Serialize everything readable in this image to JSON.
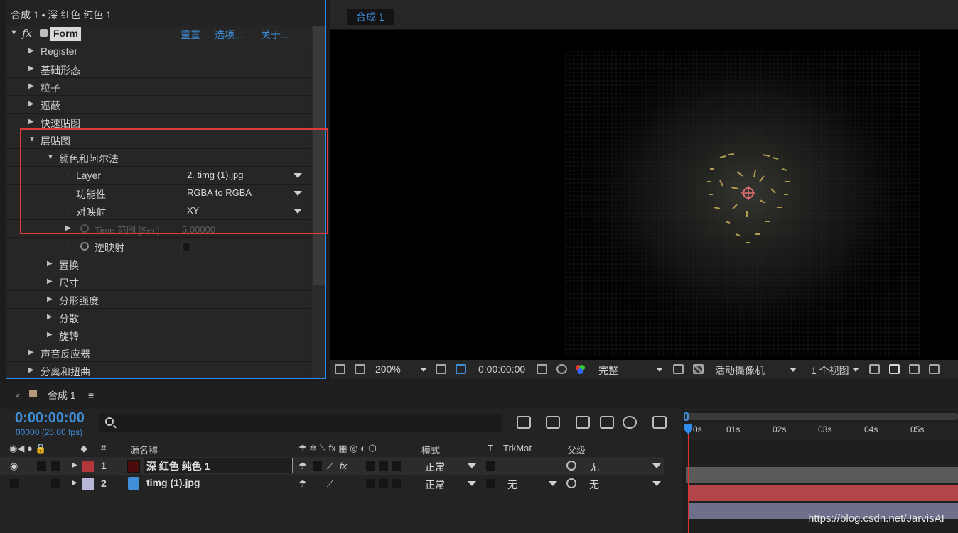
{
  "effect_panel": {
    "title": "合成 1 • 深 红色 纯色 1",
    "effect_name": "Form",
    "links": {
      "reset": "重置",
      "options": "选项...",
      "about": "关于..."
    },
    "groups": [
      {
        "label": "Register"
      },
      {
        "label": "基础形态"
      },
      {
        "label": "粒子"
      },
      {
        "label": "遮蔽"
      },
      {
        "label": "快速贴图"
      },
      {
        "label": "层贴图"
      },
      {
        "label": "颜色和阿尔法"
      }
    ],
    "params": {
      "layer": {
        "label": "Layer",
        "value": "2. timg (1).jpg"
      },
      "functionality": {
        "label": "功能性",
        "value": "RGBA to RGBA"
      },
      "map_over": {
        "label": "对映射",
        "value": "XY"
      },
      "time_span": {
        "label": "Time 范围 [Sec]",
        "value": "5.00000"
      },
      "invert_map": {
        "label": "逆映射"
      }
    },
    "more_groups": [
      {
        "label": "置换"
      },
      {
        "label": "尺寸"
      },
      {
        "label": "分形强度"
      },
      {
        "label": "分散"
      },
      {
        "label": "旋转"
      }
    ],
    "bottom_groups": [
      {
        "label": "声音反应器"
      },
      {
        "label": "分离和扭曲"
      }
    ],
    "highlight_color": "#e23a3a"
  },
  "viewer": {
    "tab": "合成 1",
    "zoom": "200%",
    "timecode": "0:00:00:00",
    "resolution": "完整",
    "camera": "活动摄像机",
    "views": "1 个视图"
  },
  "timeline": {
    "tab": "合成 1",
    "timecode": "0:00:00:00",
    "frames": "00000 (25.00 fps)",
    "columns": {
      "num": "#",
      "source": "源名称",
      "mode": "模式",
      "t": "T",
      "trkmat": "TrkMat",
      "parent": "父级"
    },
    "layers": [
      {
        "num": "1",
        "name": "深 红色 纯色 1",
        "mode": "正常",
        "trkmat": "",
        "parent": "无",
        "label_color": "#b4373b"
      },
      {
        "num": "2",
        "name": "timg (1).jpg",
        "mode": "正常",
        "trkmat": "无",
        "parent": "无",
        "label_color": "#b7b7d6"
      }
    ],
    "ruler_ticks": [
      "0s",
      "01s",
      "02s",
      "03s",
      "04s",
      "05s"
    ]
  },
  "watermark": "https://blog.csdn.net/JarvisAI",
  "colors": {
    "accent": "#3f8ed8",
    "panel": "#232323",
    "bg": "#1d1d1d"
  }
}
